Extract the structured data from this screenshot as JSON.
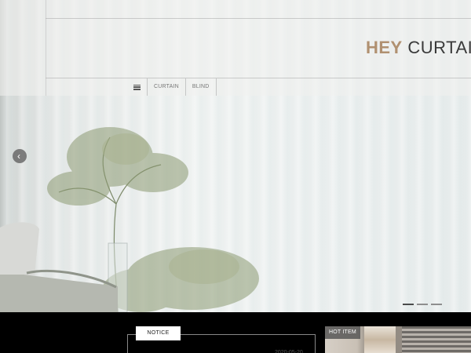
{
  "brand": {
    "hey": "HEY",
    "curtain": "CURTAIN"
  },
  "nav": {
    "menu_icon": "hamburger-icon",
    "items": [
      {
        "label": "CURTAIN"
      },
      {
        "label": "BLIND"
      }
    ]
  },
  "slider": {
    "prev_icon": "chevron-left-icon",
    "total_slides": 3,
    "active_slide": 1
  },
  "notice": {
    "tab_label": "NOTICE",
    "date": "2020-05-20"
  },
  "hot_item": {
    "label": "HOT ITEM"
  },
  "colors": {
    "brand_accent": "#b09070",
    "brand_text": "#3a3a3a",
    "footer_background": "#000000"
  }
}
